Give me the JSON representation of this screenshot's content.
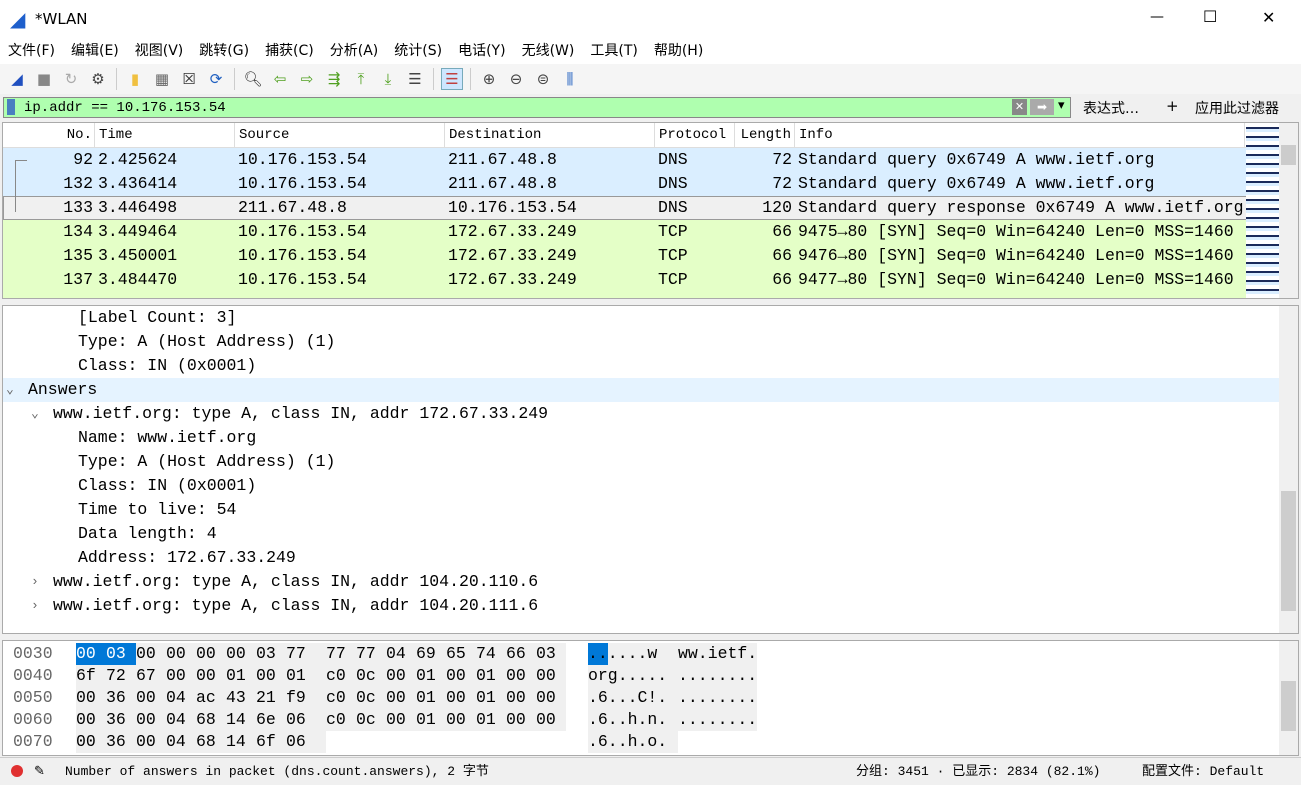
{
  "window": {
    "title": "*WLAN",
    "minimize": "—",
    "maximize": "☐",
    "close": "✕"
  },
  "menu": [
    "文件(F)",
    "编辑(E)",
    "视图(V)",
    "跳转(G)",
    "捕获(C)",
    "分析(A)",
    "统计(S)",
    "电话(Y)",
    "无线(W)",
    "工具(T)",
    "帮助(H)"
  ],
  "toolbar": [
    {
      "icon": "shark-fin-start-icon",
      "glyph": "◢",
      "color": "#2050c0"
    },
    {
      "icon": "stop-icon",
      "glyph": "■",
      "color": "#888"
    },
    {
      "icon": "restart-icon",
      "glyph": "↻",
      "color": "#aaa"
    },
    {
      "icon": "options-gear-icon",
      "glyph": "⚙",
      "color": "#444"
    },
    {
      "sep": true
    },
    {
      "icon": "open-folder-icon",
      "glyph": "▮",
      "color": "#f0c040"
    },
    {
      "icon": "save-file-icon",
      "glyph": "▦",
      "color": "#666"
    },
    {
      "icon": "close-file-icon",
      "glyph": "☒",
      "color": "#333"
    },
    {
      "icon": "reload-file-icon",
      "glyph": "⟳",
      "color": "#2060c0"
    },
    {
      "sep": true
    },
    {
      "icon": "find-icon",
      "glyph": "🔍︎",
      "color": "#333"
    },
    {
      "icon": "go-back-icon",
      "glyph": "⇦",
      "color": "#50a020"
    },
    {
      "icon": "go-forward-icon",
      "glyph": "⇨",
      "color": "#50a020"
    },
    {
      "icon": "go-to-packet-icon",
      "glyph": "⇶",
      "color": "#50a020"
    },
    {
      "icon": "go-first-icon",
      "glyph": "⤒",
      "color": "#50a020"
    },
    {
      "icon": "go-last-icon",
      "glyph": "⤓",
      "color": "#50a020"
    },
    {
      "icon": "auto-scroll-icon",
      "glyph": "☰",
      "color": "#444"
    },
    {
      "sep": true
    },
    {
      "icon": "colorize-icon",
      "glyph": "☰",
      "color": "#c04040",
      "active": true
    },
    {
      "sep": true
    },
    {
      "icon": "zoom-in-icon",
      "glyph": "⊕",
      "color": "#444"
    },
    {
      "icon": "zoom-out-icon",
      "glyph": "⊖",
      "color": "#444"
    },
    {
      "icon": "zoom-reset-icon",
      "glyph": "⊜",
      "color": "#444"
    },
    {
      "icon": "resize-columns-icon",
      "glyph": "⫼",
      "color": "#2060c0"
    }
  ],
  "filter": {
    "value": "ip.addr == 10.176.153.54",
    "expression_label": "表达式…",
    "plus": "+",
    "apply_label": "应用此过滤器",
    "clear": "✕",
    "apply_arrow": "➡",
    "dropdown": "▾"
  },
  "packet_list": {
    "columns": [
      "No.",
      "Time",
      "Source",
      "Destination",
      "Protocol",
      "Length",
      "Info"
    ],
    "rows": [
      {
        "no": "92",
        "time": "2.425624",
        "src": "10.176.153.54",
        "dst": "211.67.48.8",
        "proto": "DNS",
        "len": "72",
        "info": "Standard query 0x6749 A www.ietf.org",
        "color": "#daeeff"
      },
      {
        "no": "132",
        "time": "3.436414",
        "src": "10.176.153.54",
        "dst": "211.67.48.8",
        "proto": "DNS",
        "len": "72",
        "info": "Standard query 0x6749 A www.ietf.org",
        "color": "#daeeff"
      },
      {
        "no": "133",
        "time": "3.446498",
        "src": "211.67.48.8",
        "dst": "10.176.153.54",
        "proto": "DNS",
        "len": "120",
        "info": "Standard query response 0x6749 A www.ietf.org",
        "color": "#f0f0f0",
        "selected": true
      },
      {
        "no": "134",
        "time": "3.449464",
        "src": "10.176.153.54",
        "dst": "172.67.33.249",
        "proto": "TCP",
        "len": "66",
        "info": "9475→80 [SYN] Seq=0 Win=64240 Len=0 MSS=1460",
        "color": "#e4ffc7"
      },
      {
        "no": "135",
        "time": "3.450001",
        "src": "10.176.153.54",
        "dst": "172.67.33.249",
        "proto": "TCP",
        "len": "66",
        "info": "9476→80 [SYN] Seq=0 Win=64240 Len=0 MSS=1460",
        "color": "#e4ffc7"
      },
      {
        "no": "137",
        "time": "3.484470",
        "src": "10.176.153.54",
        "dst": "172.67.33.249",
        "proto": "TCP",
        "len": "66",
        "info": "9477→80 [SYN] Seq=0 Win=64240 Len=0 MSS=1460",
        "color": "#e4ffc7"
      }
    ]
  },
  "details": [
    {
      "indent": 3,
      "text": "[Label Count: 3]"
    },
    {
      "indent": 3,
      "text": "Type: A (Host Address) (1)"
    },
    {
      "indent": 3,
      "text": "Class: IN (0x0001)"
    },
    {
      "indent": 1,
      "text": "Answers",
      "toggle": "expanded",
      "highlight": true
    },
    {
      "indent": 2,
      "text": "www.ietf.org: type A, class IN, addr 172.67.33.249",
      "toggle": "expanded"
    },
    {
      "indent": 3,
      "text": "Name: www.ietf.org"
    },
    {
      "indent": 3,
      "text": "Type: A (Host Address) (1)"
    },
    {
      "indent": 3,
      "text": "Class: IN (0x0001)"
    },
    {
      "indent": 3,
      "text": "Time to live: 54"
    },
    {
      "indent": 3,
      "text": "Data length: 4"
    },
    {
      "indent": 3,
      "text": "Address: 172.67.33.249"
    },
    {
      "indent": 2,
      "text": "www.ietf.org: type A, class IN, addr 104.20.110.6",
      "toggle": "collapsed"
    },
    {
      "indent": 2,
      "text": "www.ietf.org: type A, class IN, addr 104.20.111.6",
      "toggle": "collapsed"
    }
  ],
  "bytes": [
    {
      "offset": "0030",
      "hex": [
        "00",
        "03",
        "00",
        "00",
        "00",
        "00",
        "03",
        "77",
        "77",
        "77",
        "04",
        "69",
        "65",
        "74",
        "66",
        "03"
      ],
      "ascii": "..... .w ww.ietf.",
      "a1": "......w",
      "a2": "ww.ietf.",
      "sel": [
        0,
        1
      ]
    },
    {
      "offset": "0040",
      "hex": [
        "6f",
        "72",
        "67",
        "00",
        "00",
        "01",
        "00",
        "01",
        "c0",
        "0c",
        "00",
        "01",
        "00",
        "01",
        "00",
        "00"
      ],
      "a1": "org.....",
      "a2": "........"
    },
    {
      "offset": "0050",
      "hex": [
        "00",
        "36",
        "00",
        "04",
        "ac",
        "43",
        "21",
        "f9",
        "c0",
        "0c",
        "00",
        "01",
        "00",
        "01",
        "00",
        "00"
      ],
      "a1": ".6...C!.",
      "a2": "........"
    },
    {
      "offset": "0060",
      "hex": [
        "00",
        "36",
        "00",
        "04",
        "68",
        "14",
        "6e",
        "06",
        "c0",
        "0c",
        "00",
        "01",
        "00",
        "01",
        "00",
        "00"
      ],
      "a1": ".6..h.n.",
      "a2": "........"
    },
    {
      "offset": "0070",
      "hex": [
        "00",
        "36",
        "00",
        "04",
        "68",
        "14",
        "6f",
        "06"
      ],
      "a1": ".6..h.o.",
      "a2": ""
    }
  ],
  "status": {
    "message": "Number of answers in packet (dns.count.answers), 2 字节",
    "packets": "分组: 3451 · 已显示: 2834 (82.1%)",
    "profile": "配置文件: Default"
  },
  "colors": {
    "selection": "#0078d7",
    "filter_ok": "#afffaf",
    "dns_row": "#daeeff",
    "tcp_row": "#e4ffc7"
  }
}
